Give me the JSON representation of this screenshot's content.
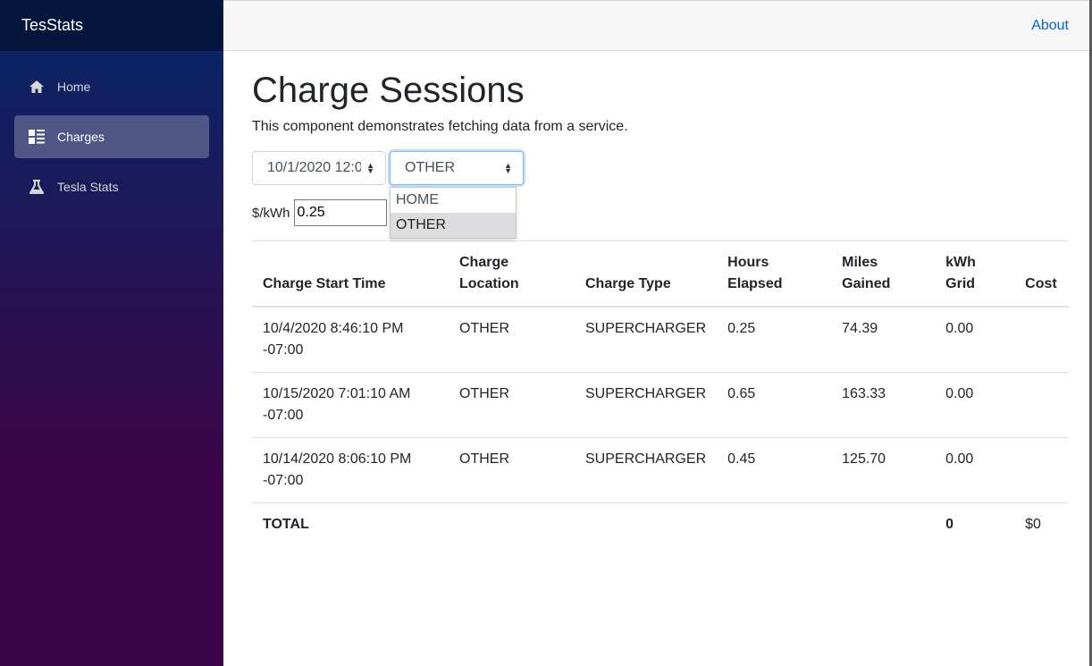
{
  "app": {
    "brand": "TesStats"
  },
  "sidebar": {
    "items": [
      {
        "label": "Home",
        "icon": "home-icon"
      },
      {
        "label": "Charges",
        "icon": "list-icon",
        "active": true
      },
      {
        "label": "Tesla Stats",
        "icon": "beaker-icon"
      }
    ]
  },
  "topbar": {
    "about": "About"
  },
  "page": {
    "title": "Charge Sessions",
    "subtitle": "This component demonstrates fetching data from a service."
  },
  "filters": {
    "date_value": "10/1/2020 12:0",
    "location_value": "OTHER",
    "location_options": [
      "HOME",
      "OTHER"
    ],
    "rate_label": "$/kWh",
    "rate_value": "0.25"
  },
  "table": {
    "headers": [
      "Charge Start Time",
      "Charge Location",
      "Charge Type",
      "Hours Elapsed",
      "Miles Gained",
      "kWh Grid",
      "Cost"
    ],
    "rows": [
      [
        "10/4/2020 8:46:10 PM -07:00",
        "OTHER",
        "SUPERCHARGER",
        "0.25",
        "74.39",
        "0.00",
        ""
      ],
      [
        "10/15/2020 7:01:10 AM -07:00",
        "OTHER",
        "SUPERCHARGER",
        "0.65",
        "163.33",
        "0.00",
        ""
      ],
      [
        "10/14/2020 8:06:10 PM -07:00",
        "OTHER",
        "SUPERCHARGER",
        "0.45",
        "125.70",
        "0.00",
        ""
      ]
    ],
    "total": {
      "label": "TOTAL",
      "kwh": "0",
      "cost": "$0"
    }
  },
  "colors": {
    "sidebar_top": "#052767",
    "sidebar_bottom": "#3a0647",
    "link": "#0366d6"
  }
}
